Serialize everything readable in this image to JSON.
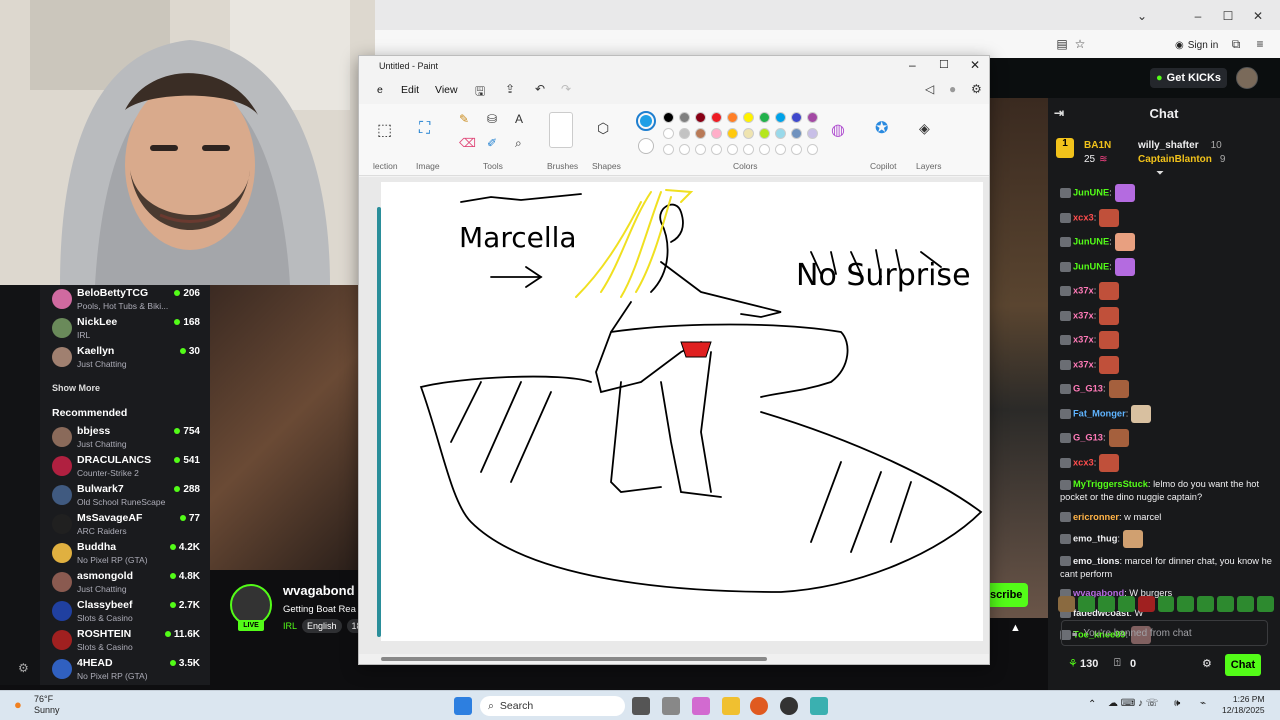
{
  "browser": {
    "sign_in": "Sign in"
  },
  "kick": {
    "get_kicks": "Get KICKs"
  },
  "chat": {
    "title": "Chat",
    "leaderboard": [
      {
        "name": "BA1N",
        "value": "25"
      },
      {
        "name": "willy_shafter",
        "value": "10"
      },
      {
        "name": "CaptainBlanton",
        "value": "9"
      }
    ],
    "messages": [
      {
        "user": "JunUNE",
        "color": "#53fc18",
        "text": ":",
        "emote": "#b46be0"
      },
      {
        "user": "xcx3",
        "color": "#ff4d4d",
        "text": ":",
        "emote": "#c0503a"
      },
      {
        "user": "JunUNE",
        "color": "#53fc18",
        "text": ":",
        "emote": "#e8a080"
      },
      {
        "user": "JunUNE",
        "color": "#53fc18",
        "text": ":",
        "emote": "#b46be0"
      },
      {
        "user": "x37x",
        "color": "#ff7ab8",
        "text": ":",
        "emote": "#c0503a"
      },
      {
        "user": "x37x",
        "color": "#ff7ab8",
        "text": ":",
        "emote": "#c0503a"
      },
      {
        "user": "x37x",
        "color": "#ff7ab8",
        "text": ":",
        "emote": "#c0503a"
      },
      {
        "user": "x37x",
        "color": "#ff7ab8",
        "text": ":",
        "emote": "#c0503a"
      },
      {
        "user": "G_G13",
        "color": "#ff7ab8",
        "text": ":",
        "emote": "#a5603d"
      },
      {
        "user": "Fat_Monger",
        "color": "#5fb4ff",
        "text": ":",
        "emote": "#d8c0a0"
      },
      {
        "user": "G_G13",
        "color": "#ff7ab8",
        "text": ":",
        "emote": "#a5603d"
      },
      {
        "user": "xcx3",
        "color": "#ff4d4d",
        "text": ":",
        "emote": "#c0503a"
      },
      {
        "user": "MyTriggersStuck",
        "color": "#53fc18",
        "text": ": lelmo do you want the hot pocket or the dino nuggie captain?",
        "emote": ""
      },
      {
        "user": "ericronner",
        "color": "#ffb347",
        "text": ": w marcel",
        "emote": ""
      },
      {
        "user": "emo_thug",
        "color": "#efeff1",
        "text": ":",
        "emote": "#d0a070"
      },
      {
        "user": "emo_tions",
        "color": "#efeff1",
        "text": ": marcel for dinner chat, you know he cant perform",
        "emote": ""
      },
      {
        "user": "wvagabond",
        "color": "#b46be0",
        "text": ": W burgers",
        "emote": ""
      },
      {
        "user": "fadedwcoast",
        "color": "#efeff1",
        "text": ": W",
        "emote": ""
      },
      {
        "user": "Toe_knee89",
        "color": "#53fc18",
        "text": ":",
        "emote": "#806060"
      }
    ],
    "banned_placeholder": "You're banned from chat",
    "points": "130",
    "gift_count": "0",
    "chat_button": "Chat"
  },
  "sidebar": {
    "following": [
      {
        "name": "BeloBettyTCG",
        "category": "Pools, Hot Tubs & Biki...",
        "viewers": "206",
        "color": "#d06aa0"
      },
      {
        "name": "NickLee",
        "category": "IRL",
        "viewers": "168",
        "color": "#6a8a5a"
      },
      {
        "name": "Kaellyn",
        "category": "Just Chatting",
        "viewers": "30",
        "color": "#a08070"
      }
    ],
    "show_more": "Show More",
    "recommended_label": "Recommended",
    "recommended": [
      {
        "name": "bbjess",
        "category": "Just Chatting",
        "viewers": "754",
        "color": "#8a6a5a"
      },
      {
        "name": "DRACULANCS",
        "category": "Counter-Strike 2",
        "viewers": "541",
        "color": "#b02040"
      },
      {
        "name": "Bulwark7",
        "category": "Old School RuneScape",
        "viewers": "288",
        "color": "#405a80"
      },
      {
        "name": "MsSavageAF",
        "category": "ARC Raiders",
        "viewers": "77",
        "color": "#202020"
      },
      {
        "name": "Buddha",
        "category": "No Pixel RP (GTA)",
        "viewers": "4.2K",
        "color": "#e0b040"
      },
      {
        "name": "asmongold",
        "category": "Just Chatting",
        "viewers": "4.8K",
        "color": "#8a5a50"
      },
      {
        "name": "Classybeef",
        "category": "Slots & Casino",
        "viewers": "2.7K",
        "color": "#2040a0"
      },
      {
        "name": "ROSHTEIN",
        "category": "Slots & Casino",
        "viewers": "11.6K",
        "color": "#a02020"
      },
      {
        "name": "4HEAD",
        "category": "No Pixel RP (GTA)",
        "viewers": "3.5K",
        "color": "#3060c0"
      }
    ]
  },
  "stream": {
    "streamer": "wvagabond",
    "title": "Getting Boat Rea",
    "live": "LIVE",
    "category": "IRL",
    "language": "English",
    "age": "18",
    "subscribe": "scribe"
  },
  "paint": {
    "title": "Untitled - Paint",
    "menu": [
      "e",
      "Edit",
      "View"
    ],
    "groups": [
      "lection",
      "Image",
      "Tools",
      "Brushes",
      "Shapes",
      "Colors",
      "Copilot",
      "Layers"
    ],
    "palette": [
      "#000000",
      "#7f7f7f",
      "#880015",
      "#ed1c24",
      "#ff7f27",
      "#fff200",
      "#22b14c",
      "#00a2e8",
      "#3f48cc",
      "#a349a4",
      "#ffffff",
      "#c3c3c3",
      "#b97a57",
      "#ffaec9",
      "#ffc90e",
      "#efe4b0",
      "#b5e61d",
      "#99d9ea",
      "#7092be",
      "#c8bfe7"
    ],
    "selected_color": "#1e9fe6",
    "drawing_text_1": "Marcella",
    "drawing_text_2": "No Surprise"
  },
  "taskbar": {
    "temperature": "76°F",
    "weather": "Sunny",
    "search": "Search",
    "time": "1:26 PM",
    "date": "12/18/2025"
  }
}
